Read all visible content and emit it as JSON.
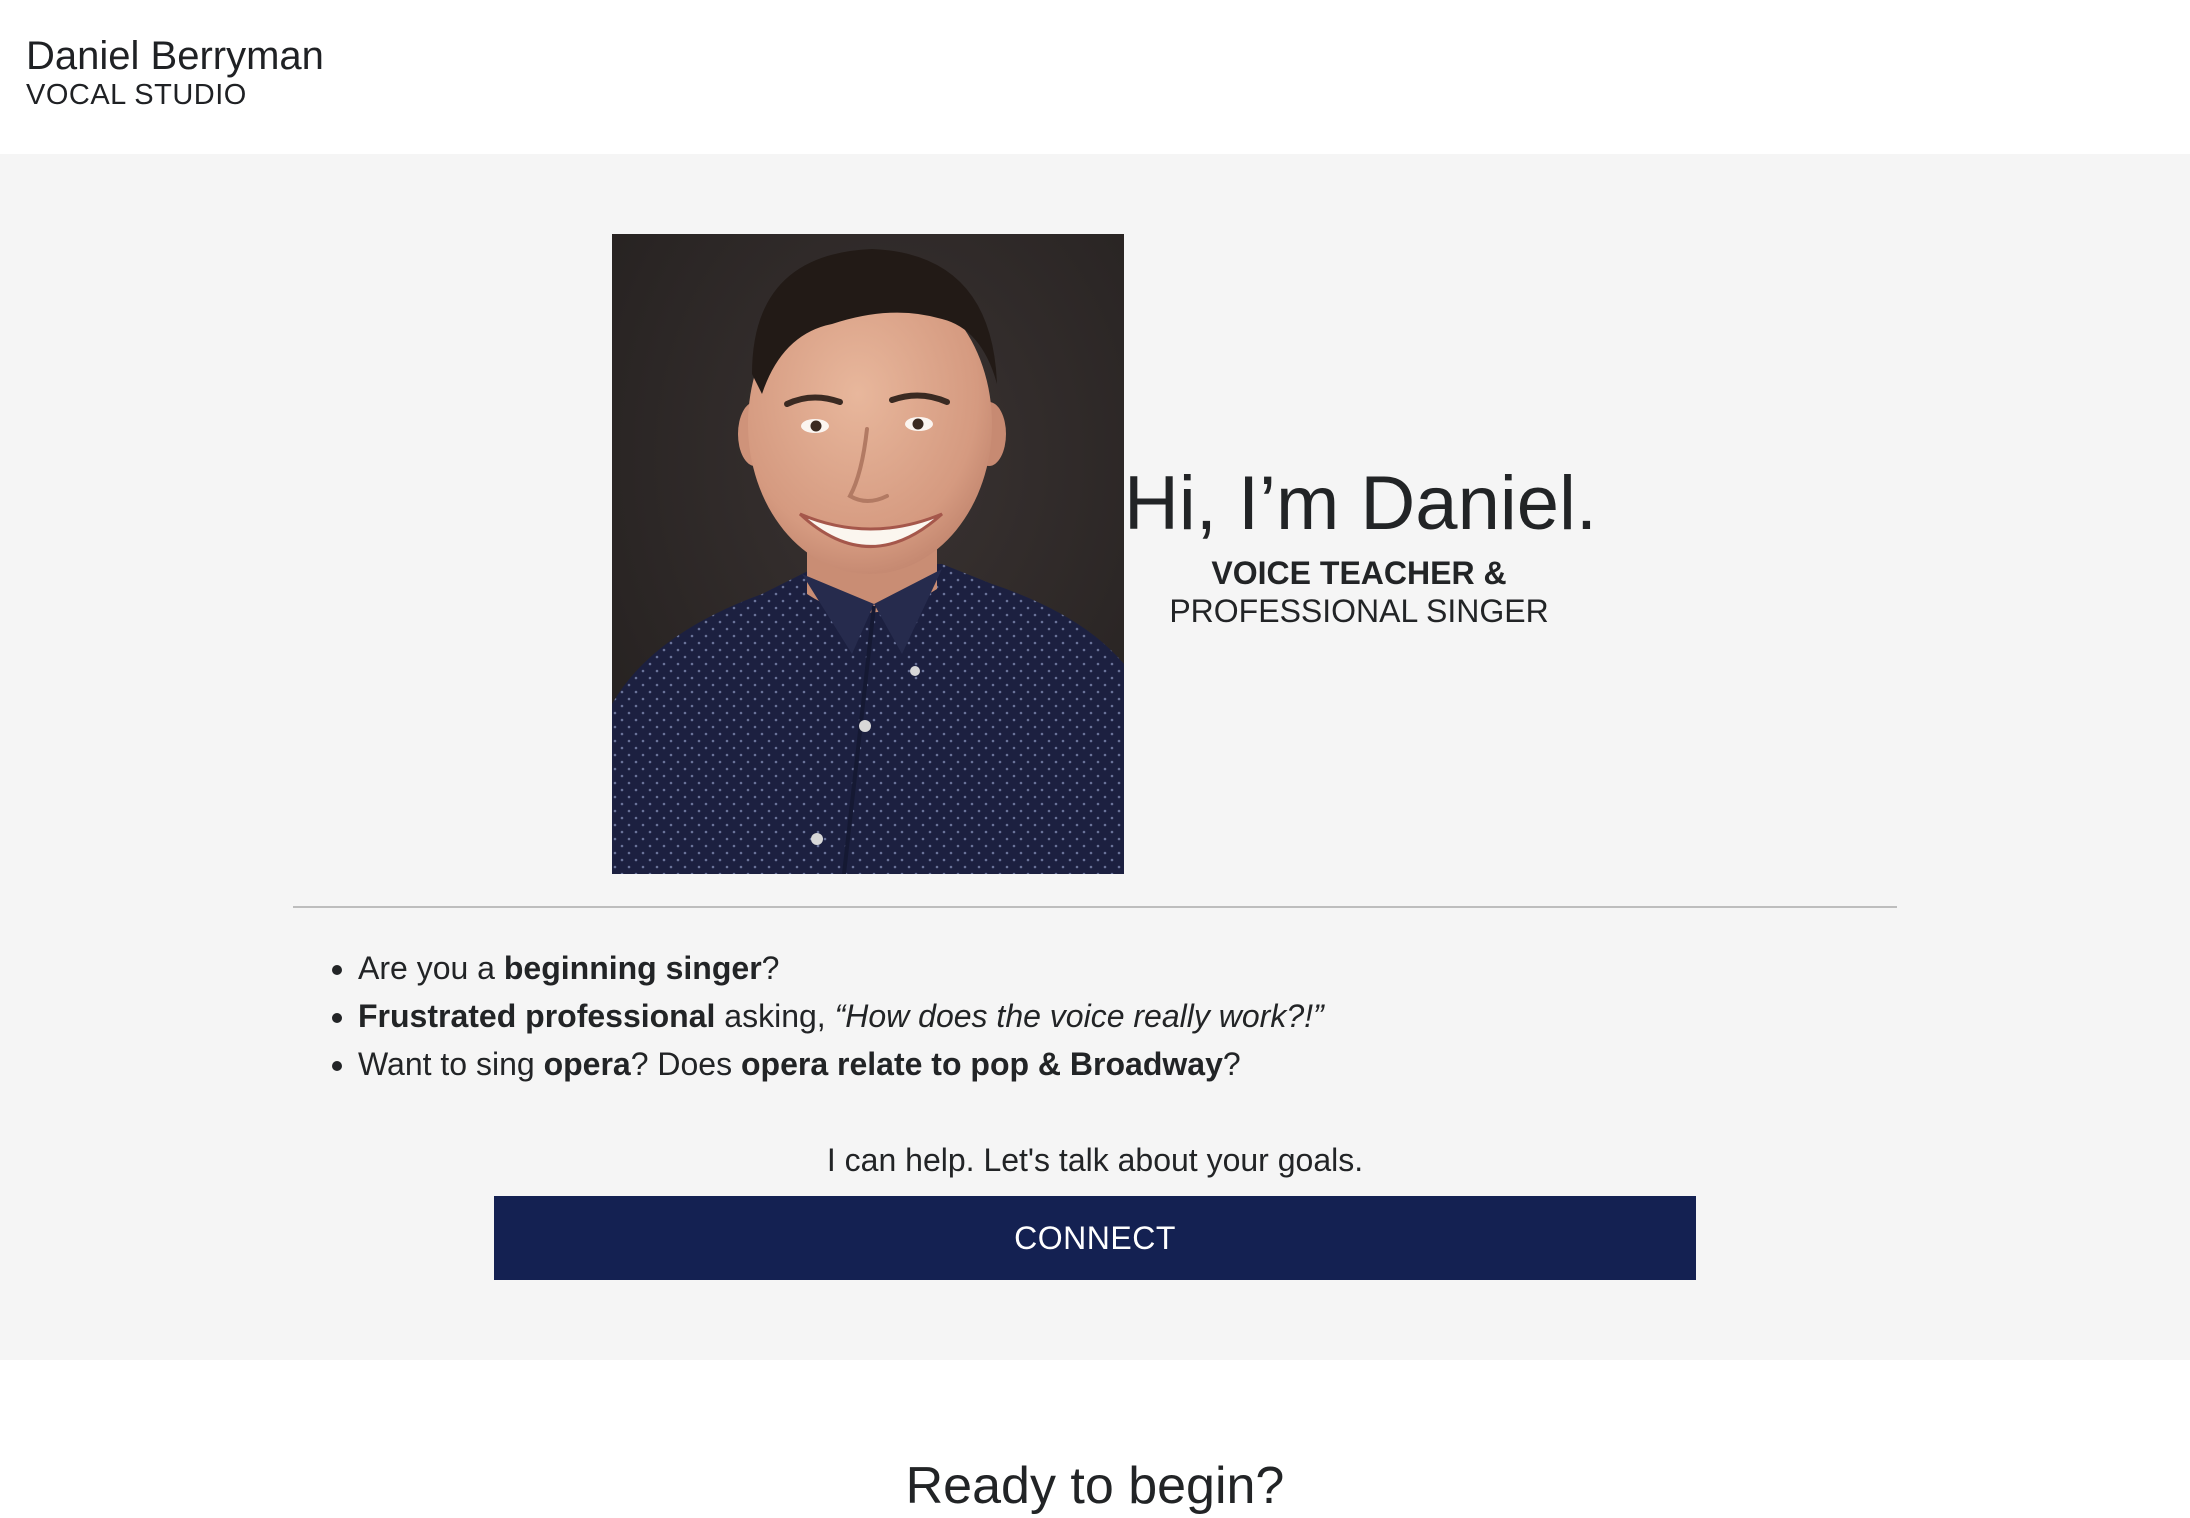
{
  "header": {
    "brand_name": "Daniel Berryman",
    "brand_sub": "VOCAL STUDIO"
  },
  "hero": {
    "greeting": "Hi, I’m Daniel.",
    "role_line1": "VOICE TEACHER &",
    "role_line2": "PROFESSIONAL SINGER",
    "photo_alt": "Portrait of Daniel Berryman",
    "pitch": {
      "item1": {
        "a": "Are you a ",
        "b": "beginning singer",
        "c": "?"
      },
      "item2": {
        "a": "Frustrated professional",
        "b": " asking, ",
        "c": "“How does the voice really work?!”"
      },
      "item3": {
        "a": "Want to sing ",
        "b": "opera",
        "c": "? Does ",
        "d": "opera relate to pop & Broadway",
        "e": "?"
      }
    },
    "cta_text": "I can help. Let's talk about your goals.",
    "connect_label": "CONNECT"
  },
  "next_section": {
    "heading": "Ready to begin?"
  },
  "colors": {
    "hero_bg": "#f5f5f5",
    "button_bg": "#142152",
    "text": "#222426",
    "divider": "#bdbdbd"
  }
}
